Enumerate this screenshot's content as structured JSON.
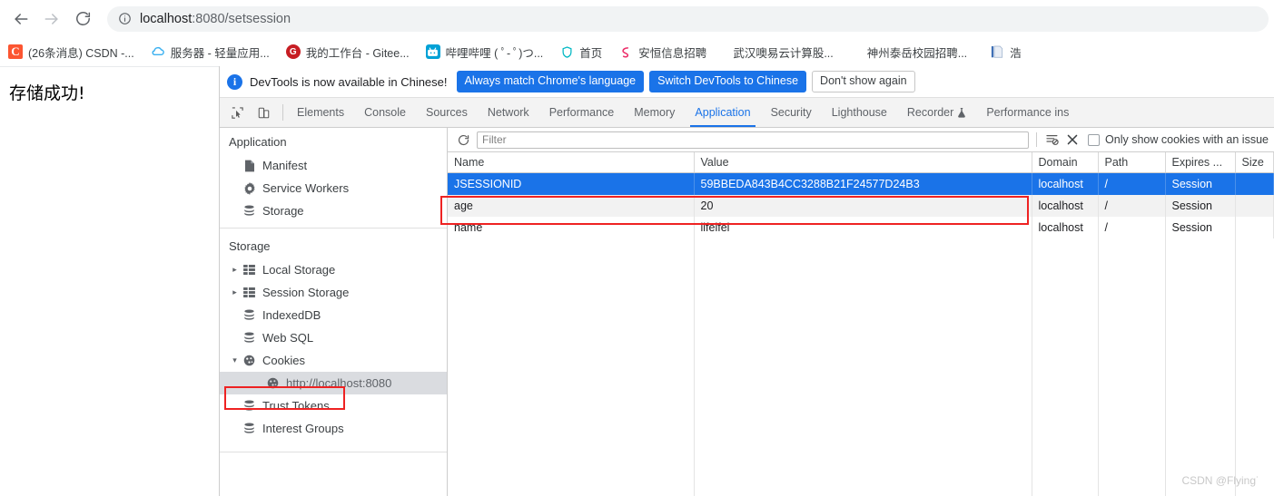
{
  "browser": {
    "back_tooltip": "Back",
    "forward_tooltip": "Forward",
    "reload_tooltip": "Reload",
    "url_host": "localhost",
    "url_rest": ":8080/setsession",
    "site_info_icon": "info-circle-icon"
  },
  "bookmarks": [
    {
      "label": "(26条消息) CSDN -...",
      "icon": "csdn-favicon",
      "glyph": "C"
    },
    {
      "label": "服务器 - 轻量应用...",
      "icon": "tencent-cloud-favicon",
      "glyph": "☁"
    },
    {
      "label": "我的工作台 - Gitee...",
      "icon": "gitee-favicon",
      "glyph": "G"
    },
    {
      "label": "哔哩哔哩 ( ﾟ- ﾟ)つ...",
      "icon": "bilibili-favicon",
      "glyph": "tv"
    },
    {
      "label": "首页",
      "icon": "shield-favicon",
      "glyph": "◎"
    },
    {
      "label": "安恒信息招聘",
      "icon": "dbapp-favicon",
      "glyph": "℘"
    },
    {
      "label": "武汉噢易云计算股...",
      "icon": "generic-favicon",
      "glyph": ""
    },
    {
      "label": "神州泰岳校园招聘...",
      "icon": "generic-favicon",
      "glyph": ""
    },
    {
      "label": "浩",
      "icon": "document-favicon",
      "glyph": "▤"
    }
  ],
  "page": {
    "body_text": "存储成功!"
  },
  "devtools": {
    "banner": {
      "info_icon": "info-icon",
      "message": "DevTools is now available in Chinese!",
      "btn_always_match": "Always match Chrome's language",
      "btn_switch": "Switch DevTools to Chinese",
      "btn_dont_show": "Don't show again"
    },
    "toolbar_icons": [
      {
        "name": "inspect-element-icon"
      },
      {
        "name": "device-toolbar-icon"
      }
    ],
    "tabs": [
      {
        "label": "Elements",
        "active": false
      },
      {
        "label": "Console",
        "active": false
      },
      {
        "label": "Sources",
        "active": false
      },
      {
        "label": "Network",
        "active": false
      },
      {
        "label": "Performance",
        "active": false
      },
      {
        "label": "Memory",
        "active": false
      },
      {
        "label": "Application",
        "active": true
      },
      {
        "label": "Security",
        "active": false
      },
      {
        "label": "Lighthouse",
        "active": false
      },
      {
        "label": "Recorder",
        "active": false,
        "badge": "flask"
      },
      {
        "label": "Performance ins",
        "active": false
      }
    ],
    "sidebar": {
      "application_title": "Application",
      "application_items": [
        {
          "label": "Manifest",
          "icon": "manifest-file-icon"
        },
        {
          "label": "Service Workers",
          "icon": "gear-icon"
        },
        {
          "label": "Storage",
          "icon": "database-icon"
        }
      ],
      "storage_title": "Storage",
      "storage_items": [
        {
          "label": "Local Storage",
          "icon": "table-icon",
          "twisty": "▸",
          "indent": 0
        },
        {
          "label": "Session Storage",
          "icon": "table-icon",
          "twisty": "▸",
          "indent": 0
        },
        {
          "label": "IndexedDB",
          "icon": "database-icon",
          "twisty": "",
          "indent": 0
        },
        {
          "label": "Web SQL",
          "icon": "database-icon",
          "twisty": "",
          "indent": 0
        },
        {
          "label": "Cookies",
          "icon": "cookie-icon",
          "twisty": "▾",
          "indent": 0,
          "highlighted": true
        },
        {
          "label": "http://localhost:8080",
          "icon": "cookie-icon",
          "twisty": "",
          "indent": 1,
          "selected": true
        },
        {
          "label": "Trust Tokens",
          "icon": "database-icon",
          "twisty": "",
          "indent": 0
        },
        {
          "label": "Interest Groups",
          "icon": "database-icon",
          "twisty": "",
          "indent": 0
        }
      ]
    },
    "cookies_panel": {
      "refresh_icon": "refresh-icon",
      "filter_placeholder": "Filter",
      "filter_value": "",
      "clear_filter_icon": "clear-filter-icon",
      "clear_all_icon": "close-x-icon",
      "only_issues_label": "Only show cookies with an issue",
      "only_issues_checked": false,
      "columns": [
        "Name",
        "Value",
        "Domain",
        "Path",
        "Expires ...",
        "Size"
      ],
      "rows": [
        {
          "name": "JSESSIONID",
          "value": "59BBEDA843B4CC3288B21F24577D24B3",
          "domain": "localhost",
          "path": "/",
          "expires": "Session",
          "size": "",
          "selected": true,
          "highlighted": true
        },
        {
          "name": "age",
          "value": "20",
          "domain": "localhost",
          "path": "/",
          "expires": "Session",
          "size": "",
          "selected": false
        },
        {
          "name": "name",
          "value": "lifeifei",
          "domain": "localhost",
          "path": "/",
          "expires": "Session",
          "size": "",
          "selected": false
        }
      ]
    }
  },
  "watermark": "CSDN @Flying˙",
  "colors": {
    "accent": "#1a73e8",
    "highlight_box": "#ee2222",
    "selected_row": "#1a73e8"
  }
}
